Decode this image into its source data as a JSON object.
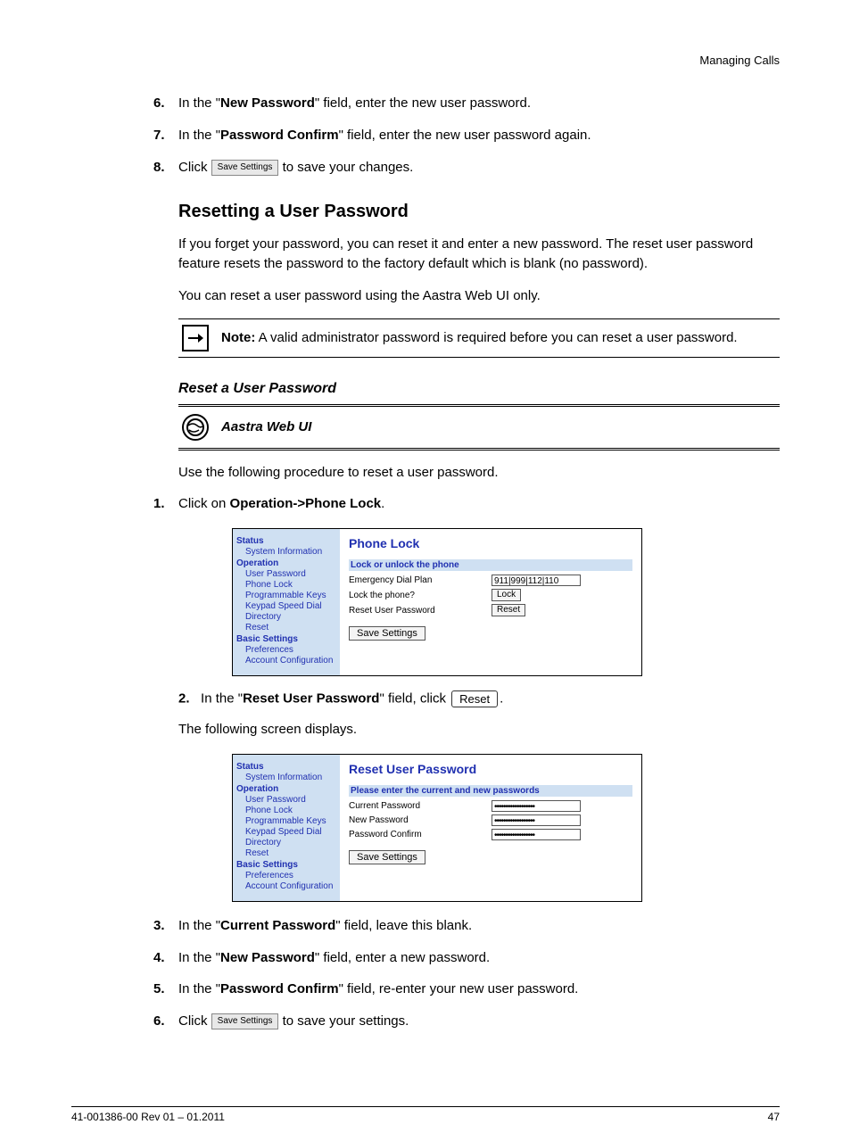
{
  "header": "Managing Calls",
  "p1_prefix": "In the \"",
  "p1_bold": "New Password",
  "p1_suffix": "\" field, enter the new user password.",
  "p2_prefix": "In the \"",
  "p2_bold": "Password Confirm",
  "p2_suffix": "\" field, enter the new user password again.",
  "p3_prefix": "Click ",
  "p3_suffix": " to save your changes.",
  "save_settings_btn": "Save Settings",
  "heading_reset": "Resetting a User Password",
  "reset_para": "If you forget your password, you can reset it and enter a new password. The reset user password feature resets the password to the factory default which is blank (no password).",
  "reset_para2": "You can reset a user password using the Aastra Web UI only.",
  "note_label": "Note:",
  "note_text": " A valid administrator password is required before you can reset a user password.",
  "subhead_reset_italic": "Reset a User Password",
  "webui_label": "Aastra Web UI",
  "webui_instruction": "Use the following procedure to reset a user password.",
  "step1_prefix": "Click on ",
  "step1_bold": "Operation->Phone Lock",
  "step1_suffix": ".",
  "shot1": {
    "sidebar": {
      "status": "Status",
      "sys_info": "System Information",
      "operation": "Operation",
      "user_pw": "User Password",
      "phone_lock": "Phone Lock",
      "prog_keys": "Programmable Keys",
      "keypad": "Keypad Speed Dial",
      "directory": "Directory",
      "reset": "Reset",
      "basic": "Basic Settings",
      "prefs": "Preferences",
      "acct": "Account Configuration"
    },
    "title": "Phone Lock",
    "strip": "Lock or unlock the phone",
    "row1": {
      "lbl": "Emergency Dial Plan",
      "val": "911|999|112|110"
    },
    "row2": {
      "lbl": "Lock the phone?",
      "btn": "Lock"
    },
    "row3": {
      "lbl": "Reset User Password",
      "btn": "Reset"
    },
    "save": "Save Settings"
  },
  "step2_prefix": "In the \"",
  "step2_bold": "Reset User Password",
  "step2_mid": "\" field, click ",
  "step2_suffix": ".",
  "reset_btn_label": "Reset",
  "step2_after": "The following screen displays.",
  "shot2": {
    "title": "Reset User Password",
    "strip": "Please enter the current and new passwords",
    "row1": "Current Password",
    "row2": "New Password",
    "row3": "Password Confirm",
    "mask": "••••••••••••••••••",
    "save": "Save Settings"
  },
  "step3_prefix": "In the \"",
  "step3_bold": "Current Password",
  "step3_suffix": "\" field, leave this blank.",
  "step4_prefix": "In the \"",
  "step4_bold": "New Password",
  "step4_suffix": "\" field, enter a new password.",
  "step5_prefix": "In the \"",
  "step5_bold": "Password Confirm",
  "step5_suffix": "\" field, re-enter your new user password.",
  "step6_prefix": "Click ",
  "step6_suffix": " to save your settings.",
  "footer_left": "41-001386-00 Rev 01 – 01.2011",
  "footer_right": "47"
}
